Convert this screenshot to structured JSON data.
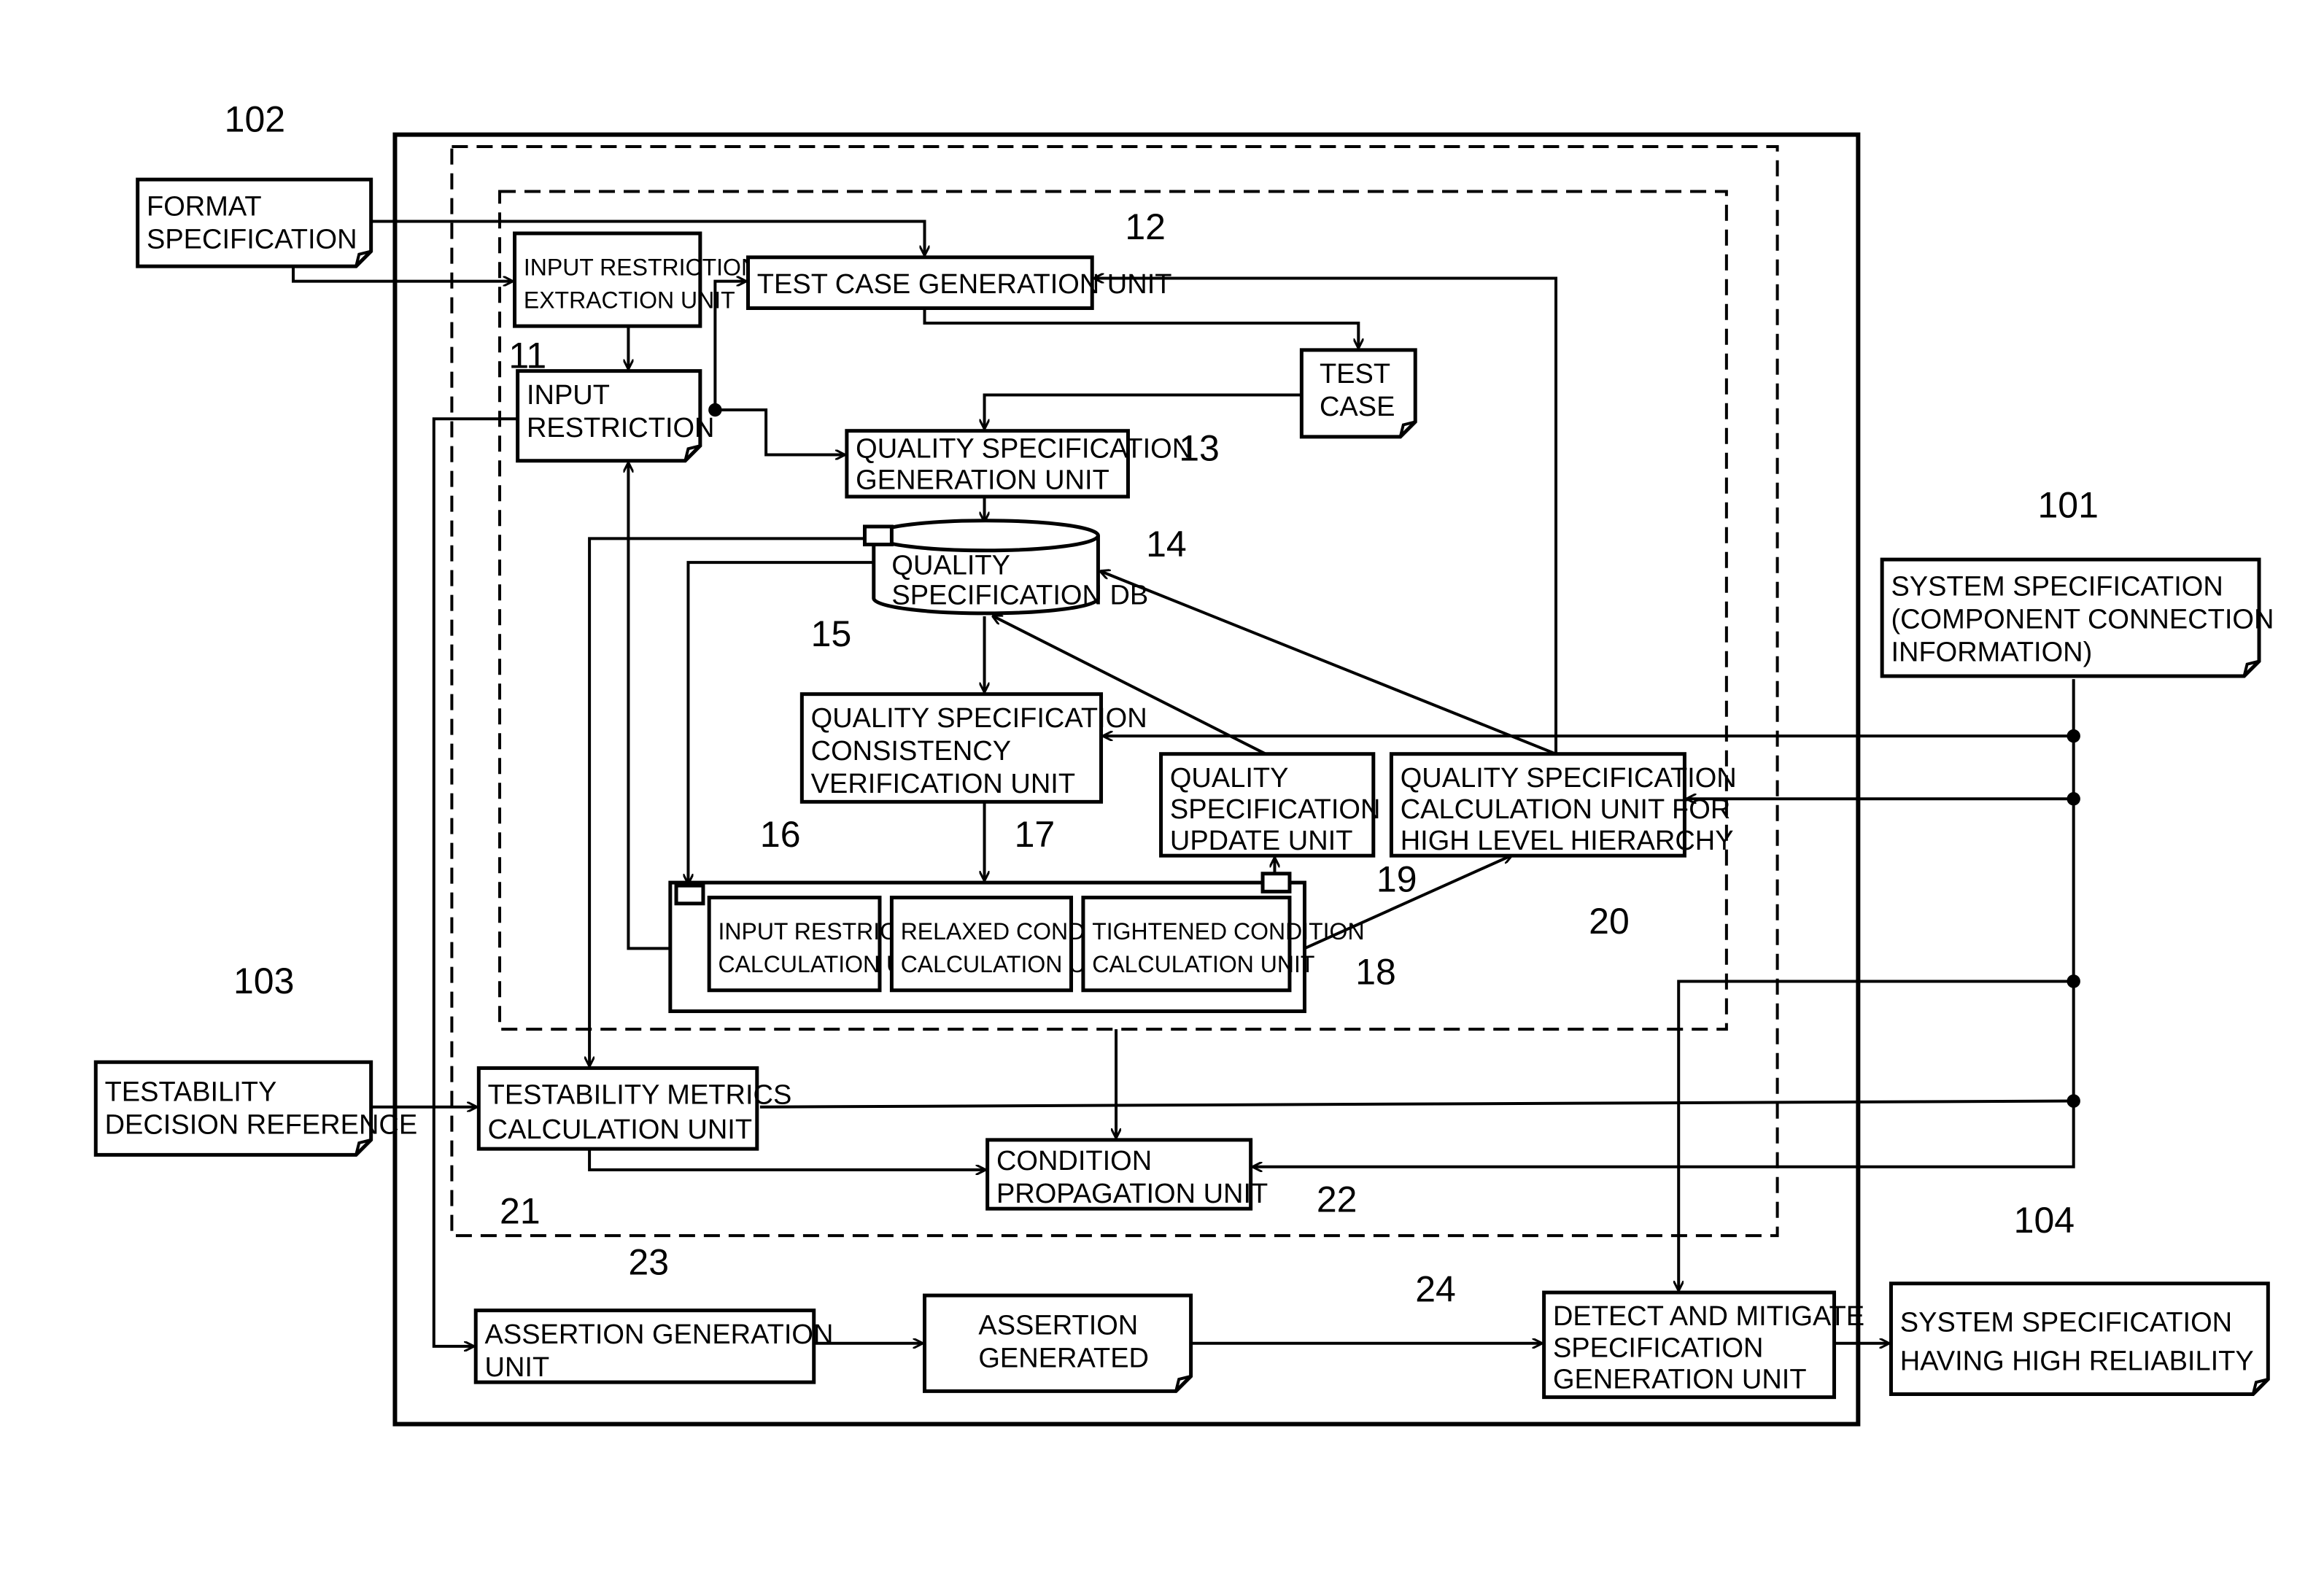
{
  "figure": {
    "refs": {
      "format_spec": "102",
      "system_spec": "101",
      "testability_ref": "103",
      "high_reliability": "104",
      "u11": "11",
      "u12": "12",
      "u13": "13",
      "u14": "14",
      "u15": "15",
      "u16": "16",
      "u17": "17",
      "u18": "18",
      "u19": "19",
      "u20": "20",
      "u21": "21",
      "u22": "22",
      "u23": "23",
      "u24": "24"
    },
    "docs": {
      "format_spec": [
        "FORMAT",
        "SPECIFICATION"
      ],
      "system_spec": [
        "SYSTEM SPECIFICATION",
        "(COMPONENT CONNECTION",
        " INFORMATION)"
      ],
      "testability_ref": [
        "TESTABILITY",
        "DECISION REFERENCE"
      ],
      "high_reliability": [
        "SYSTEM SPECIFICATION",
        "HAVING HIGH RELIABILITY"
      ],
      "input_restriction": [
        "INPUT",
        "RESTRICTION"
      ],
      "test_case": [
        "TEST",
        "CASE"
      ],
      "assertion": [
        "ASSERTION",
        "GENERATED"
      ]
    },
    "units": {
      "input_restriction_extraction": [
        "INPUT RESTRICTION",
        "EXTRACTION UNIT"
      ],
      "test_case_generation": [
        "TEST CASE GENERATION UNIT"
      ],
      "quality_spec_generation": [
        "QUALITY SPECIFICATION",
        "GENERATION UNIT"
      ],
      "quality_spec_db": [
        "QUALITY",
        "SPECIFICATION DB"
      ],
      "consistency_verification": [
        "QUALITY SPECIFICATION",
        "CONSISTENCY",
        "VERIFICATION UNIT"
      ],
      "input_restriction_calc": [
        "INPUT RESTRICTION",
        "CALCULATION UNIT"
      ],
      "relaxed_condition_calc": [
        "RELAXED CONDITION",
        "CALCULATION UNIT"
      ],
      "tightened_condition_calc": [
        "TIGHTENED CONDITION",
        "CALCULATION UNIT"
      ],
      "quality_spec_update": [
        "QUALITY",
        "SPECIFICATION",
        "UPDATE UNIT"
      ],
      "high_level_calc": [
        "QUALITY SPECIFICATION",
        "CALCULATION UNIT FOR",
        "HIGH LEVEL HIERARCHY"
      ],
      "testability_metrics": [
        "TESTABILITY METRICS",
        "CALCULATION UNIT"
      ],
      "condition_propagation": [
        "CONDITION",
        "PROPAGATION UNIT"
      ],
      "assertion_generation": [
        "ASSERTION GENERATION",
        "UNIT"
      ],
      "detect_mitigate": [
        "DETECT AND MITIGATE",
        "SPECIFICATION",
        "GENERATION UNIT"
      ]
    }
  }
}
